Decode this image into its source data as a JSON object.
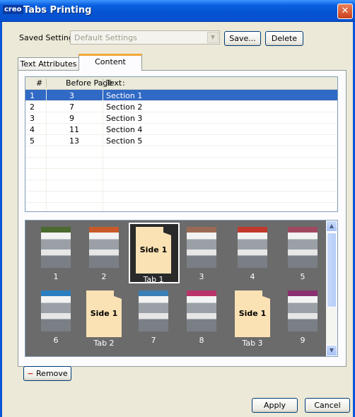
{
  "window": {
    "title": "Tabs Printing",
    "logo": "creo",
    "close_glyph": "✕"
  },
  "settings": {
    "label": "Saved Settings:",
    "value": "Default Settings",
    "save_label": "Save...",
    "delete_label": "Delete"
  },
  "tabs": [
    {
      "label": "Text Attributes"
    },
    {
      "label": "Content"
    }
  ],
  "table": {
    "headers": [
      "#",
      "Before Page",
      "Text"
    ],
    "rows": [
      {
        "num": "1",
        "before": "3",
        "text": "Section 1",
        "selected": true
      },
      {
        "num": "2",
        "before": "7",
        "text": "Section 2"
      },
      {
        "num": "3",
        "before": "9",
        "text": "Section 3"
      },
      {
        "num": "4",
        "before": "11",
        "text": "Section 4"
      },
      {
        "num": "5",
        "before": "13",
        "text": "Section 5"
      }
    ]
  },
  "thumbs": {
    "row1": [
      {
        "label": "1",
        "kind": "page",
        "accent": "#4a6a2f"
      },
      {
        "label": "2",
        "kind": "page",
        "accent": "#c85a2a"
      },
      {
        "label": "Tab 1",
        "kind": "tab",
        "side": "Side 1",
        "selected": true
      },
      {
        "label": "3",
        "kind": "page",
        "accent": "#9b6a55"
      },
      {
        "label": "4",
        "kind": "page",
        "accent": "#c0392b"
      },
      {
        "label": "5",
        "kind": "page",
        "accent": "#a04860"
      }
    ],
    "row2": [
      {
        "label": "6",
        "kind": "page",
        "accent": "#2b7fc0"
      },
      {
        "label": "Tab 2",
        "kind": "tab",
        "side": "Side 1"
      },
      {
        "label": "7",
        "kind": "page",
        "accent": "#3a7fb5"
      },
      {
        "label": "8",
        "kind": "page",
        "accent": "#b8356a"
      },
      {
        "label": "Tab 3",
        "kind": "tab",
        "side": "Side 1"
      },
      {
        "label": "9",
        "kind": "page",
        "accent": "#8a3070"
      }
    ]
  },
  "remove": {
    "icon": "−",
    "label": "Remove"
  },
  "footer": {
    "apply_label": "Apply",
    "cancel_label": "Cancel"
  },
  "colors": {
    "title_bar": "#0554d2",
    "selection": "#316ac5",
    "tab_highlight": "#f1a83b",
    "thumb_bg": "#6b6b6b",
    "tab_fill": "#fbe2b5"
  }
}
